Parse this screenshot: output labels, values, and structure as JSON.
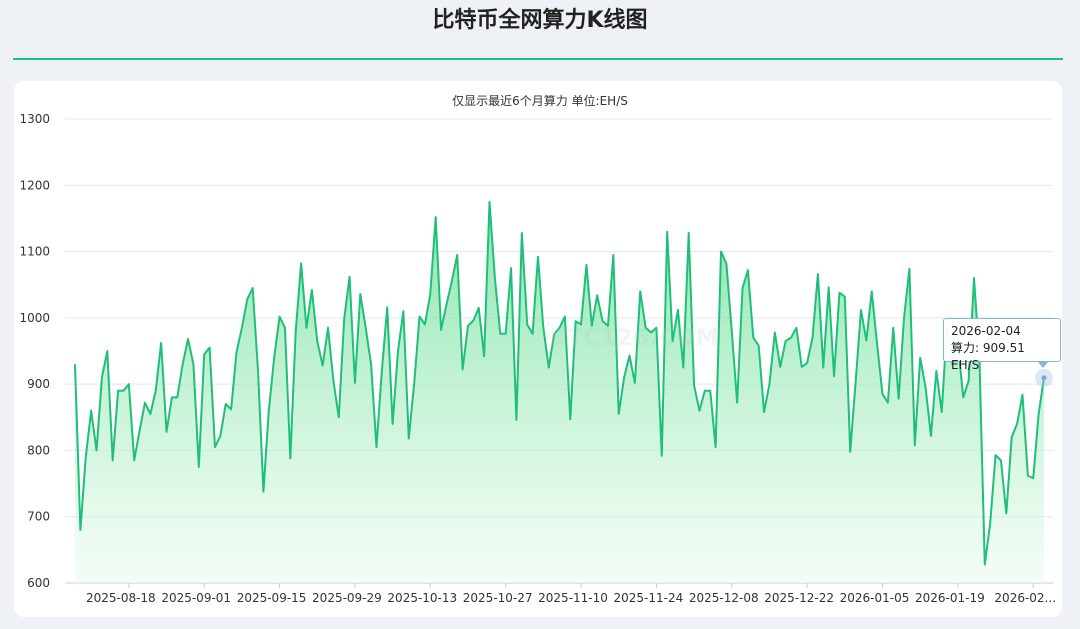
{
  "page": {
    "title": "比特币全网算力K线图",
    "subtitle": "仅显示最近6个月算力 单位:EH/S",
    "watermark": "BTC126.COM"
  },
  "colors": {
    "line": "#1fbf7a",
    "fill_top": "#5fdc8f",
    "fill_bottom": "#e9fbee",
    "grid": "#e4e7ec",
    "rule": "#1fbf7a"
  },
  "tooltip": {
    "date": "2026-02-04",
    "label": "算力",
    "value": "909.51",
    "unit": "EH/S"
  },
  "chart_data": {
    "type": "area",
    "title": "比特币全网算力K线图",
    "subtitle": "仅显示最近6个月算力 单位:EH/S",
    "ylim": [
      600,
      1300
    ],
    "yticks": [
      600,
      700,
      800,
      900,
      1000,
      1100,
      1200,
      1300
    ],
    "grid": true,
    "start_date": "2025-08-08",
    "end_date": "2026-02-04",
    "xticks": [
      "2025-08-18",
      "2025-09-01",
      "2025-09-15",
      "2025-09-29",
      "2025-10-13",
      "2025-10-27",
      "2025-11-10",
      "2025-11-24",
      "2025-12-08",
      "2025-12-22",
      "2026-01-05",
      "2026-01-19",
      "2026-02..."
    ],
    "series": [
      {
        "values": [
          930,
          680,
          790,
          860,
          800,
          910,
          950,
          785,
          890,
          890,
          900,
          785,
          830,
          872,
          855,
          890,
          962,
          828,
          880,
          880,
          930,
          968,
          930,
          775,
          945,
          955,
          805,
          822,
          870,
          862,
          948,
          985,
          1028,
          1045,
          920,
          738,
          860,
          940,
          1002,
          985,
          788,
          980,
          1082,
          985,
          1042,
          965,
          928,
          985,
          905,
          850,
          998,
          1062,
          902,
          1036,
          985,
          930,
          805,
          920,
          1016,
          840,
          950,
          1010,
          818,
          900,
          1002,
          990,
          1036,
          1152,
          982,
          1020,
          1055,
          1095,
          922,
          988,
          996,
          1015,
          942,
          1175,
          1060,
          976,
          976,
          1075,
          846,
          1128,
          990,
          976,
          1092,
          985,
          925,
          975,
          985,
          1002,
          847,
          995,
          990,
          1080,
          988,
          1034,
          995,
          988,
          1095,
          855,
          910,
          943,
          902,
          1040,
          985,
          978,
          985,
          792,
          1130,
          965,
          1012,
          925,
          1128,
          898,
          860,
          890,
          890,
          805,
          1100,
          1082,
          980,
          872,
          1045,
          1072,
          970,
          958,
          858,
          900,
          978,
          926,
          965,
          970,
          985,
          926,
          932,
          970,
          1066,
          925,
          1046,
          912,
          1038,
          1032,
          798,
          902,
          1012,
          966,
          1040,
          960,
          885,
          872,
          985,
          878,
          1000,
          1074,
          808,
          940,
          895,
          822,
          920,
          858,
          990,
          930,
          962,
          880,
          905,
          1060,
          940,
          628,
          690,
          793,
          785,
          705,
          820,
          840,
          884,
          762,
          758,
          855,
          909.51
        ]
      }
    ]
  }
}
